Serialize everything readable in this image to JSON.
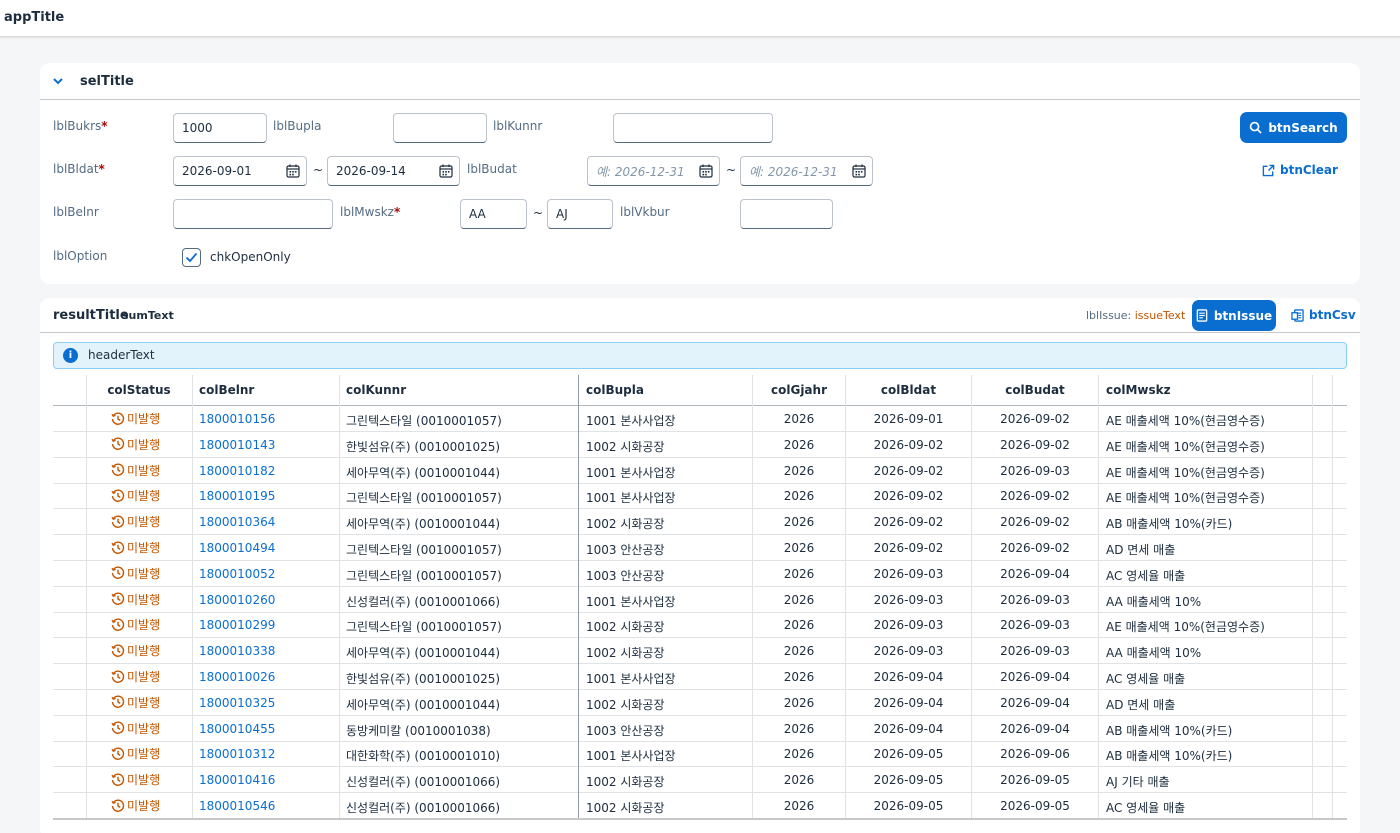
{
  "app": {
    "title": "appTitle"
  },
  "selection": {
    "title": "selTitle",
    "lblBukrs": "lblBukrs",
    "bukrs_value": "1000",
    "lblBupla": "lblBupla",
    "bupla_value": "",
    "lblKunnr": "lblKunnr",
    "kunnr_value": "",
    "lblBldat": "lblBldat",
    "bldat_from": "2026-09-01",
    "bldat_to": "2026-09-14",
    "lblBudat": "lblBudat",
    "budat_from_placeholder": "예: 2026-12-31",
    "budat_to_placeholder": "예: 2026-12-31",
    "lblBelnr": "lblBelnr",
    "belnr_value": "",
    "lblMwskz": "lblMwskz",
    "mwskz_from": "AA",
    "mwskz_to": "AJ",
    "lblVkbur": "lblVkbur",
    "vkbur_value": "",
    "lblOption": "lblOption",
    "chkOpenOnly": "chkOpenOnly",
    "chkOpenOnly_checked": true,
    "required_mark": "*",
    "range_sep": "~",
    "btnSearch": "btnSearch",
    "btnClear": "btnClear"
  },
  "result": {
    "title": "resultTitle",
    "sumText": "sumText",
    "lblIssue": "lblIssue:",
    "issueText": "issueText",
    "btnIssue": "btnIssue",
    "btnCsv": "btnCsv",
    "headerText": "headerText",
    "columns": {
      "colStatus": "colStatus",
      "colBelnr": "colBelnr",
      "colKunnr": "colKunnr",
      "colBupla": "colBupla",
      "colGjahr": "colGjahr",
      "colBldat": "colBldat",
      "colBudat": "colBudat",
      "colMwskz": "colMwskz"
    },
    "rows": [
      {
        "status": "미발행",
        "belnr": "1800010156",
        "kunnr": "그린텍스타일 (0010001057)",
        "bupla": "1001 본사사업장",
        "gjahr": "2026",
        "bldat": "2026-09-01",
        "budat": "2026-09-02",
        "mwskz": "AE 매출세액 10%(현금영수증)"
      },
      {
        "status": "미발행",
        "belnr": "1800010143",
        "kunnr": "한빛섬유(주) (0010001025)",
        "bupla": "1002 시화공장",
        "gjahr": "2026",
        "bldat": "2026-09-02",
        "budat": "2026-09-02",
        "mwskz": "AE 매출세액 10%(현금영수증)"
      },
      {
        "status": "미발행",
        "belnr": "1800010182",
        "kunnr": "세아무역(주) (0010001044)",
        "bupla": "1001 본사사업장",
        "gjahr": "2026",
        "bldat": "2026-09-02",
        "budat": "2026-09-03",
        "mwskz": "AE 매출세액 10%(현금영수증)"
      },
      {
        "status": "미발행",
        "belnr": "1800010195",
        "kunnr": "그린텍스타일 (0010001057)",
        "bupla": "1001 본사사업장",
        "gjahr": "2026",
        "bldat": "2026-09-02",
        "budat": "2026-09-02",
        "mwskz": "AE 매출세액 10%(현금영수증)"
      },
      {
        "status": "미발행",
        "belnr": "1800010364",
        "kunnr": "세아무역(주) (0010001044)",
        "bupla": "1002 시화공장",
        "gjahr": "2026",
        "bldat": "2026-09-02",
        "budat": "2026-09-02",
        "mwskz": "AB 매출세액 10%(카드)"
      },
      {
        "status": "미발행",
        "belnr": "1800010494",
        "kunnr": "그린텍스타일 (0010001057)",
        "bupla": "1003 안산공장",
        "gjahr": "2026",
        "bldat": "2026-09-02",
        "budat": "2026-09-02",
        "mwskz": "AD 면세 매출"
      },
      {
        "status": "미발행",
        "belnr": "1800010052",
        "kunnr": "그린텍스타일 (0010001057)",
        "bupla": "1003 안산공장",
        "gjahr": "2026",
        "bldat": "2026-09-03",
        "budat": "2026-09-04",
        "mwskz": "AC 영세율 매출"
      },
      {
        "status": "미발행",
        "belnr": "1800010260",
        "kunnr": "신성컬러(주) (0010001066)",
        "bupla": "1001 본사사업장",
        "gjahr": "2026",
        "bldat": "2026-09-03",
        "budat": "2026-09-03",
        "mwskz": "AA 매출세액 10%"
      },
      {
        "status": "미발행",
        "belnr": "1800010299",
        "kunnr": "그린텍스타일 (0010001057)",
        "bupla": "1002 시화공장",
        "gjahr": "2026",
        "bldat": "2026-09-03",
        "budat": "2026-09-03",
        "mwskz": "AE 매출세액 10%(현금영수증)"
      },
      {
        "status": "미발행",
        "belnr": "1800010338",
        "kunnr": "세아무역(주) (0010001044)",
        "bupla": "1002 시화공장",
        "gjahr": "2026",
        "bldat": "2026-09-03",
        "budat": "2026-09-03",
        "mwskz": "AA 매출세액 10%"
      },
      {
        "status": "미발행",
        "belnr": "1800010026",
        "kunnr": "한빛섬유(주) (0010001025)",
        "bupla": "1001 본사사업장",
        "gjahr": "2026",
        "bldat": "2026-09-04",
        "budat": "2026-09-04",
        "mwskz": "AC 영세율 매출"
      },
      {
        "status": "미발행",
        "belnr": "1800010325",
        "kunnr": "세아무역(주) (0010001044)",
        "bupla": "1002 시화공장",
        "gjahr": "2026",
        "bldat": "2026-09-04",
        "budat": "2026-09-04",
        "mwskz": "AD 면세 매출"
      },
      {
        "status": "미발행",
        "belnr": "1800010455",
        "kunnr": "동방케미칼 (0010001038)",
        "bupla": "1003 안산공장",
        "gjahr": "2026",
        "bldat": "2026-09-04",
        "budat": "2026-09-04",
        "mwskz": "AB 매출세액 10%(카드)"
      },
      {
        "status": "미발행",
        "belnr": "1800010312",
        "kunnr": "대한화학(주) (0010001010)",
        "bupla": "1001 본사사업장",
        "gjahr": "2026",
        "bldat": "2026-09-05",
        "budat": "2026-09-06",
        "mwskz": "AB 매출세액 10%(카드)"
      },
      {
        "status": "미발행",
        "belnr": "1800010416",
        "kunnr": "신성컬러(주) (0010001066)",
        "bupla": "1002 시화공장",
        "gjahr": "2026",
        "bldat": "2026-09-05",
        "budat": "2026-09-05",
        "mwskz": "AJ 기타 매출"
      },
      {
        "status": "미발행",
        "belnr": "1800010546",
        "kunnr": "신성컬러(주) (0010001066)",
        "bupla": "1002 시화공장",
        "gjahr": "2026",
        "bldat": "2026-09-05",
        "budat": "2026-09-05",
        "mwskz": "AC 영세율 매출"
      }
    ]
  },
  "colors": {
    "accent": "#0a6ed1",
    "status_open": "#c35500",
    "required": "#aa0808"
  },
  "icons": {
    "status": "clock-history-icon",
    "search": "search-icon",
    "clear": "clear-icon",
    "issue": "document-icon",
    "csv": "export-icon",
    "info": "info-icon",
    "calendar": "calendar-icon",
    "chevron": "chevron-down-icon"
  }
}
